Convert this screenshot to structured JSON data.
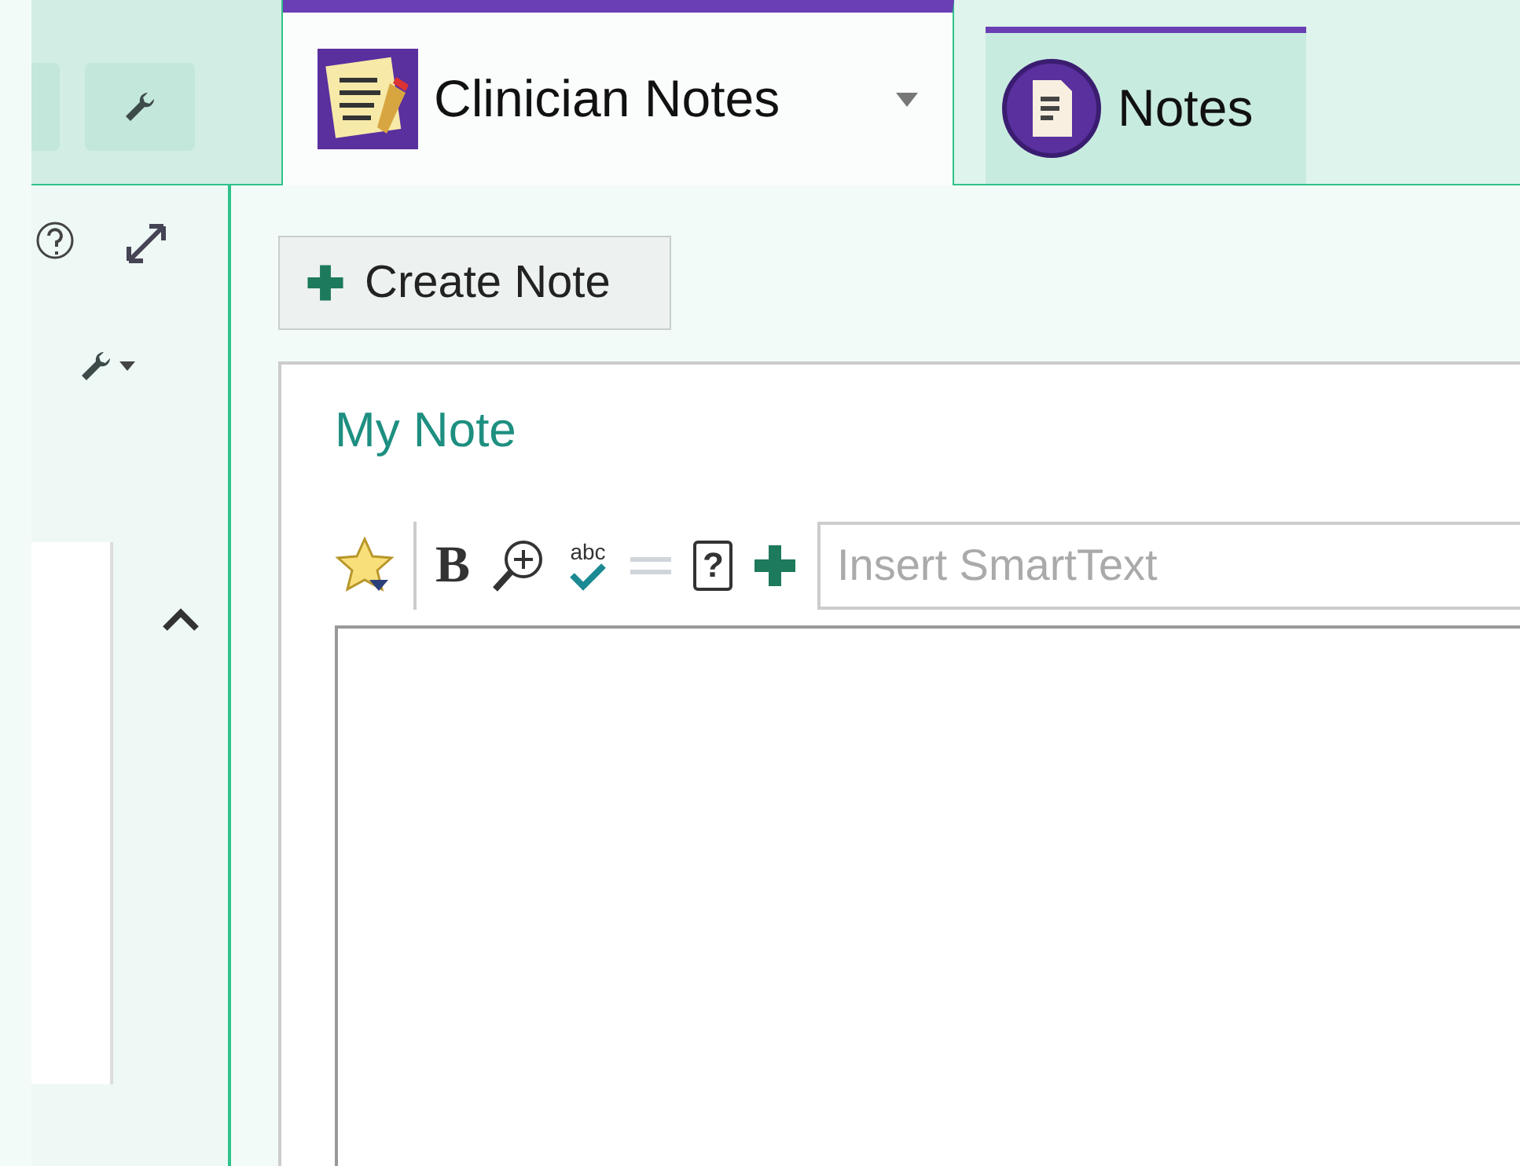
{
  "tabs": [
    {
      "kind": "clinician",
      "label": "Clinician Notes",
      "selected": true
    },
    {
      "kind": "notes",
      "label": "Notes",
      "selected": false
    }
  ],
  "create_button": {
    "label": "Create Note"
  },
  "note": {
    "title": "My Note",
    "toolbar": [
      {
        "kind": "star",
        "disabled": false
      },
      {
        "kind": "bold",
        "label": "B",
        "disabled": false
      },
      {
        "kind": "zoom",
        "disabled": false
      },
      {
        "kind": "spell",
        "label": "abc",
        "disabled": false
      },
      {
        "kind": "rule",
        "disabled": true
      },
      {
        "kind": "query",
        "label": "?",
        "disabled": false
      },
      {
        "kind": "plus",
        "disabled": false
      }
    ],
    "smarttext": {
      "placeholder": "Insert SmartText"
    }
  }
}
